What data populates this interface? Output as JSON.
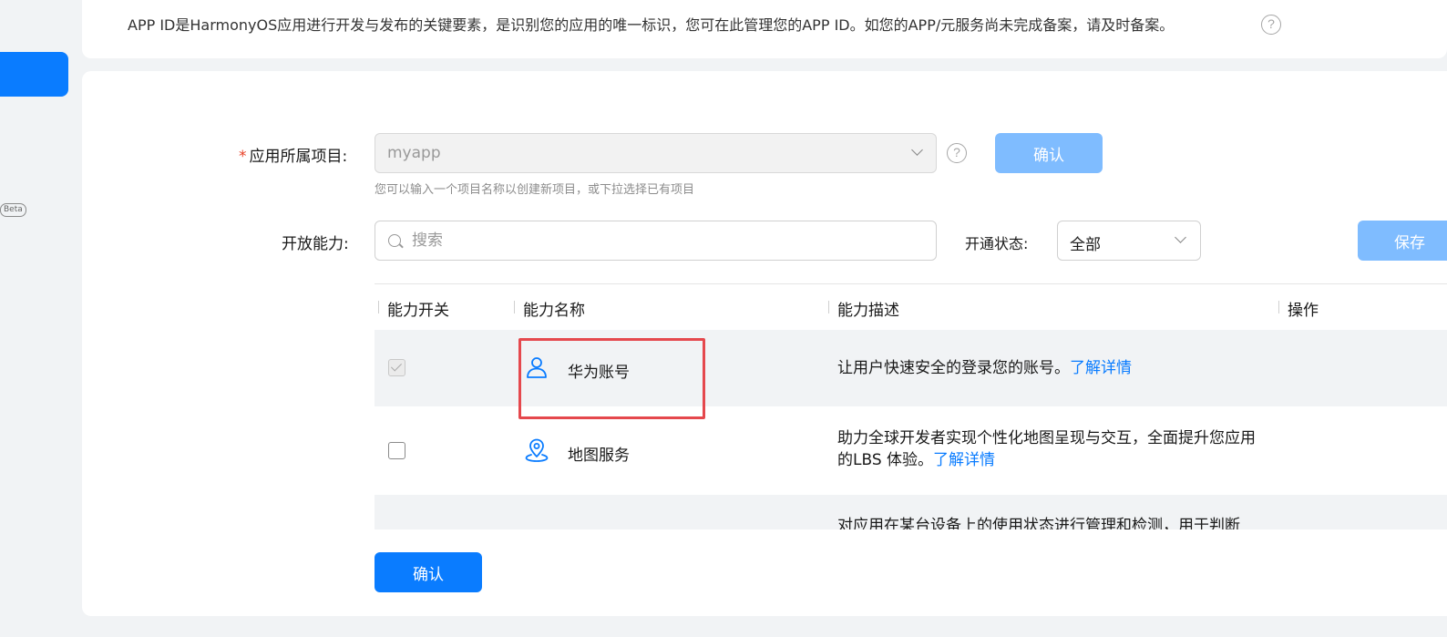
{
  "sidebar": {
    "beta_tag": "Beta"
  },
  "info": {
    "text": "APP ID是HarmonyOS应用进行开发与发布的关键要素，是识别您的应用的唯一标识，您可在此管理您的APP ID。如您的APP/元服务尚未完成备案，请及时备案。",
    "help_glyph": "?"
  },
  "form": {
    "project_label": "应用所属项目:",
    "required_mark": "*",
    "project_value": "myapp",
    "project_help_glyph": "?",
    "project_confirm": "确认",
    "project_hint": "您可以输入一个项目名称以创建新项目，或下拉选择已有项目",
    "capability_label": "开放能力:",
    "search_placeholder": "搜索",
    "status_label": "开通状态:",
    "status_value": "全部",
    "save_label": "保存"
  },
  "table": {
    "headers": [
      "能力开关",
      "能力名称",
      "能力描述",
      "操作"
    ],
    "rows": [
      {
        "checked": true,
        "disabled": true,
        "icon": "user-icon",
        "name": "华为账号",
        "desc": "让用户快速安全的登录您的账号。",
        "link": "了解详情"
      },
      {
        "checked": false,
        "disabled": false,
        "icon": "map-pin-icon",
        "name": "地图服务",
        "desc": "助力全球开发者实现个性化地图呈现与交互，全面提升您应用的LBS 体验。",
        "link": "了解详情"
      },
      {
        "desc": "对应用在某台设备上的使用状态进行管理和检测，用于判断"
      }
    ]
  },
  "footer": {
    "confirm_label": "确认"
  },
  "colors": {
    "primary": "#0a7cff",
    "primary_disabled": "#7fbcff",
    "highlight": "#e5484d"
  }
}
